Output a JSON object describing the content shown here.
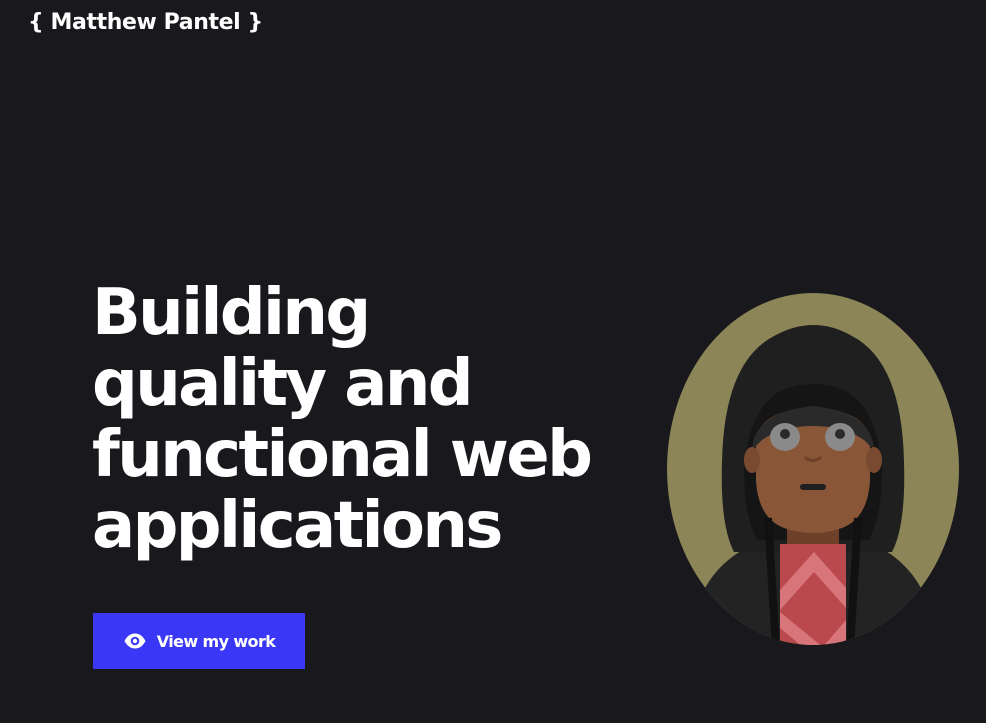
{
  "header": {
    "logo_text": "{ Matthew Pantel }"
  },
  "hero": {
    "title_lines": [
      "Building",
      "quality and",
      "functional web",
      "applications"
    ],
    "cta_label": "View my work",
    "cta_icon": "eye-icon"
  },
  "theme": {
    "background": "#18181d",
    "text": "#ffffff",
    "accent": "#3a37f7",
    "avatar_halo": "#8c8557",
    "hood": "#202020",
    "skin": "#8a5638",
    "shirt": "#b9494c"
  }
}
